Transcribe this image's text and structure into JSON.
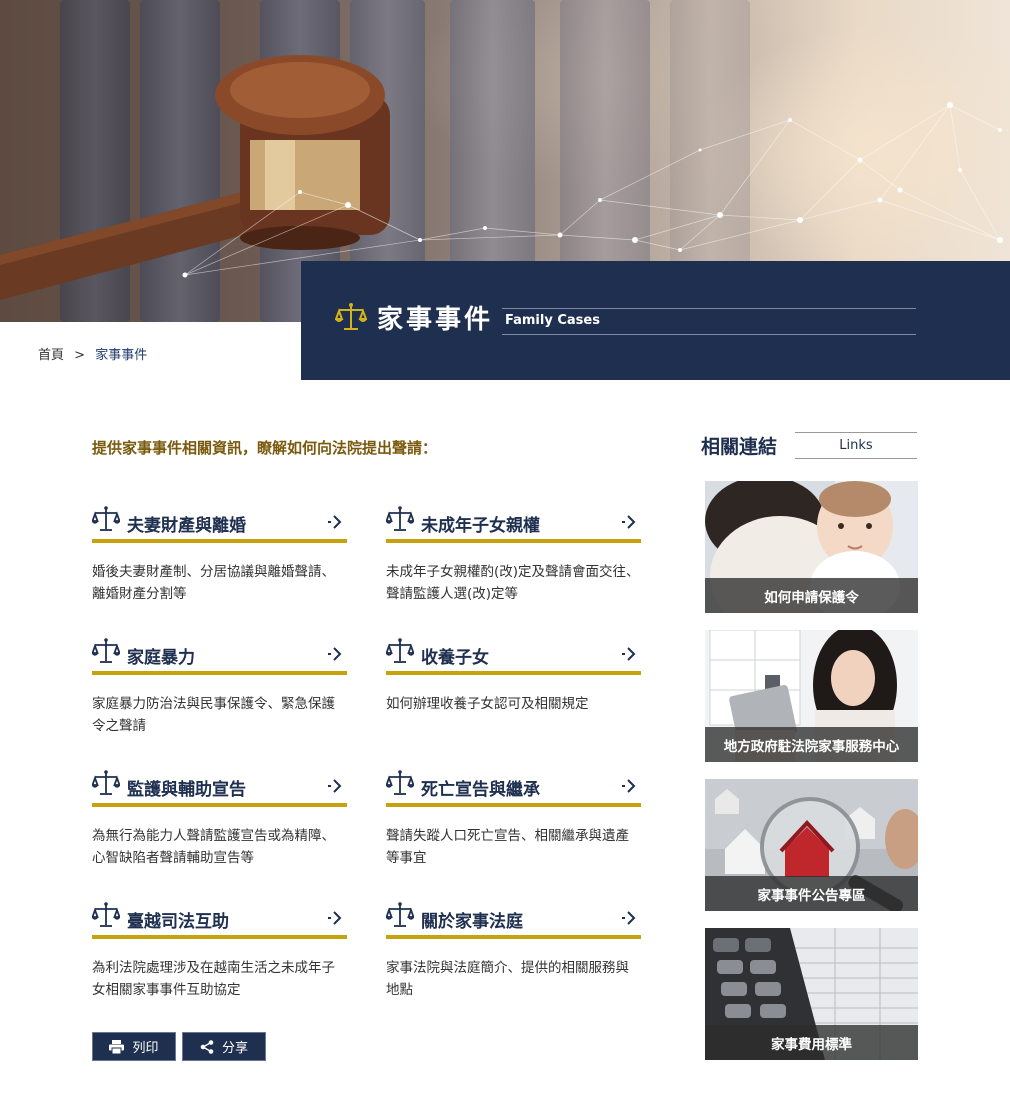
{
  "hero": {
    "title_zh": "家事事件",
    "title_en": "Family Cases",
    "icon": "scales-of-justice-icon"
  },
  "breadcrumb": {
    "home": "首頁",
    "separator": ">",
    "current": "家事事件"
  },
  "intro": "提供家事事件相關資訊，瞭解如何向法院提出聲請：",
  "categories": [
    {
      "title": "夫妻財產與離婚",
      "desc": "婚後夫妻財產制、分居協議與離婚聲請、離婚財產分割等",
      "icon": "scales-icon"
    },
    {
      "title": "未成年子女親權",
      "desc": "未成年子女親權酌(改)定及聲請會面交往、聲請監護人選(改)定等",
      "icon": "scales-icon"
    },
    {
      "title": "家庭暴力",
      "desc": "家庭暴力防治法與民事保護令、緊急保護令之聲請",
      "icon": "scales-icon"
    },
    {
      "title": "收養子女",
      "desc": "如何辦理收養子女認可及相關規定",
      "icon": "scales-icon"
    },
    {
      "title": "監護與輔助宣告",
      "desc": "為無行為能力人聲請監護宣告或為精障、心智缺陷者聲請輔助宣告等",
      "icon": "scales-icon"
    },
    {
      "title": "死亡宣告與繼承",
      "desc": "聲請失蹤人口死亡宣告、相關繼承與遺產等事宜",
      "icon": "scales-icon"
    },
    {
      "title": "臺越司法互助",
      "desc": "為利法院處理涉及在越南生活之未成年子女相關家事事件互助協定",
      "icon": "scales-icon"
    },
    {
      "title": "關於家事法庭",
      "desc": "家事法院與法庭簡介、提供的相關服務與地點",
      "icon": "scales-icon"
    }
  ],
  "buttons": {
    "print": "列印",
    "share": "分享"
  },
  "sidebar": {
    "title": "相關連結",
    "links_label": "Links",
    "tiles": [
      {
        "label": "如何申請保護令"
      },
      {
        "label": "地方政府駐法院家事服務中心"
      },
      {
        "label": "家事事件公告專區"
      },
      {
        "label": "家事費用標準"
      }
    ]
  },
  "colors": {
    "navy": "#1e2f4f",
    "gold": "#c6a30c",
    "intro_text": "#7a5a0e"
  }
}
